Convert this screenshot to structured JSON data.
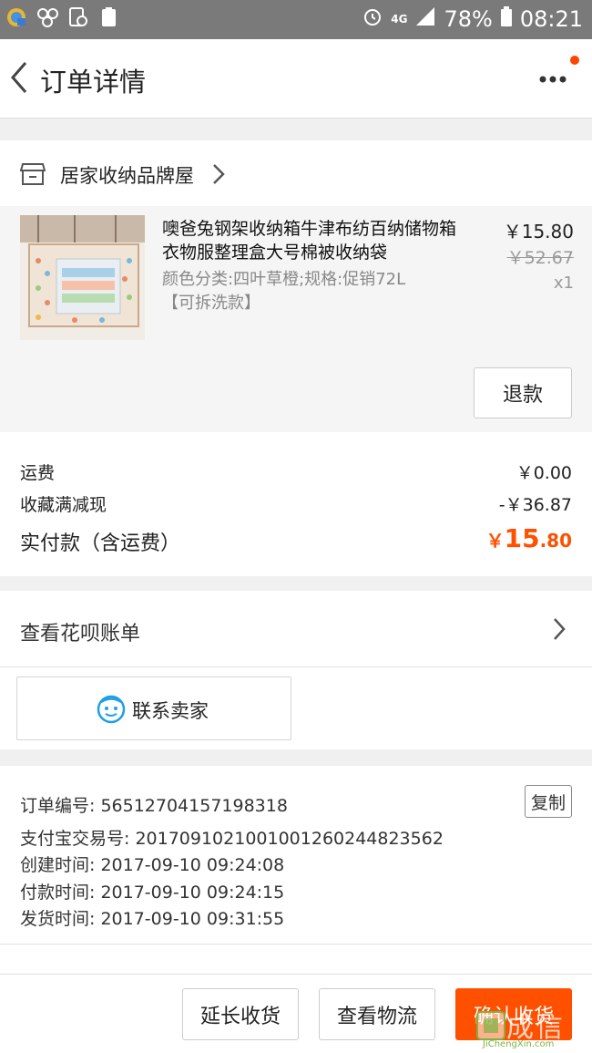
{
  "status_bar": {
    "network": "4G",
    "battery": "78%",
    "time": "08:21"
  },
  "nav": {
    "title": "订单详情"
  },
  "shop": {
    "name": "居家收纳品牌屋"
  },
  "item": {
    "title": "噢爸兔钢架收纳箱牛津布纺百纳储物箱衣物服整理盒大号棉被收纳袋",
    "sku": "颜色分类:四叶草橙;规格:促销72L【可拆洗款】",
    "price": "￥15.80",
    "original_price": "￥52.67",
    "quantity": "x1",
    "refund_label": "退款"
  },
  "fees": {
    "shipping_label": "运费",
    "shipping_value": "￥0.00",
    "discount_label": "收藏满减现",
    "discount_value": "-￥36.87",
    "total_label": "实付款（含运费）",
    "total_symbol": "￥",
    "total_int": "15",
    "total_dec": ".80"
  },
  "huabei": {
    "label": "查看花呗账单"
  },
  "contact": {
    "label": "联系卖家"
  },
  "order_info": {
    "order_no": "订单编号: 56512704157198318",
    "copy_label": "复制",
    "alipay_no": "支付宝交易号: 2017091021001001260244823562",
    "created": "创建时间: 2017-09-10 09:24:08",
    "paid": "付款时间: 2017-09-10 09:24:15",
    "shipped": "发货时间: 2017-09-10 09:31:55"
  },
  "actions": {
    "extend_label": "延长收货",
    "logistics_label": "查看物流",
    "confirm_label": "确认收货"
  },
  "watermark": {
    "text": "成信",
    "url": "JiChengXin.com"
  },
  "colors": {
    "accent": "#ff5000",
    "status_bar": "#7a7a7a"
  }
}
